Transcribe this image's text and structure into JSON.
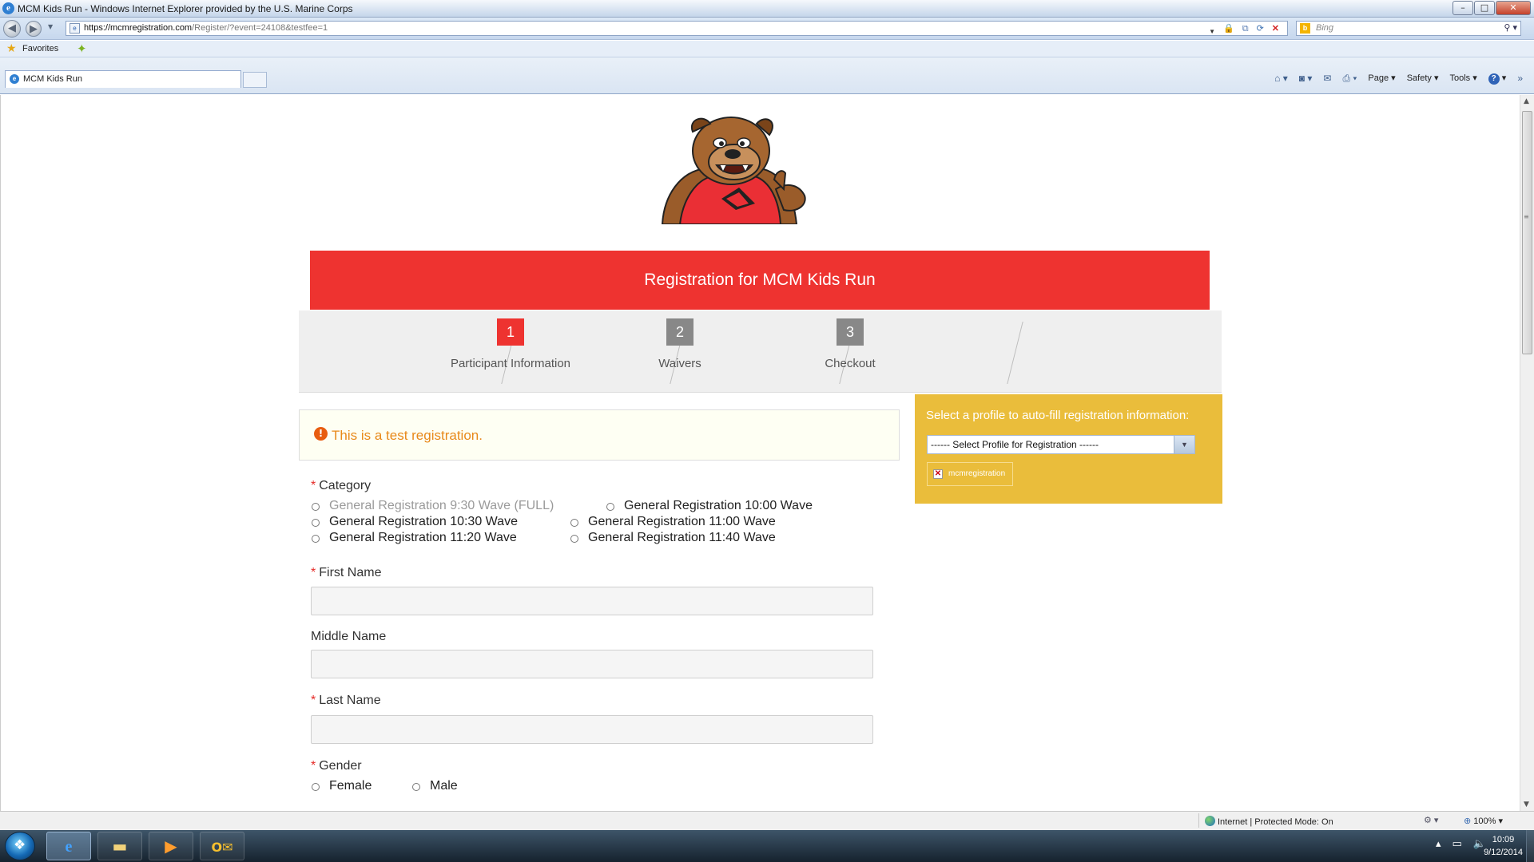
{
  "window": {
    "title": "MCM Kids Run - Windows Internet Explorer provided by the U.S. Marine Corps",
    "minimize": "–",
    "maximize": "□",
    "close": "✕"
  },
  "address": {
    "domain": "https://mcmregistration.com",
    "path": "/Register/?event=24108&testfee=1",
    "search_placeholder": "Bing"
  },
  "favorites": {
    "label": "Favorites"
  },
  "tabs": [
    {
      "label": "MCM Kids Run"
    }
  ],
  "commandbar": {
    "page": "Page ▾",
    "safety": "Safety ▾",
    "tools": "Tools ▾"
  },
  "page": {
    "header": "Registration for MCM Kids Run",
    "steps": [
      {
        "number": "1",
        "label": "Participant Information",
        "active": true
      },
      {
        "number": "2",
        "label": "Waivers",
        "active": false
      },
      {
        "number": "3",
        "label": "Checkout",
        "active": false
      }
    ],
    "notice": "This is a test registration.",
    "profile": {
      "prompt": "Select a profile to auto-fill registration information:",
      "select_value": "------ Select Profile for Registration ------",
      "chip_label": "mcmregistration"
    },
    "form": {
      "category_label": "Category",
      "categories": [
        {
          "label": "General Registration 9:30 Wave (FULL)",
          "disabled": true
        },
        {
          "label": "General Registration 10:00 Wave",
          "disabled": false
        },
        {
          "label": "General Registration 10:30 Wave",
          "disabled": false
        },
        {
          "label": "General Registration 11:00 Wave",
          "disabled": false
        },
        {
          "label": "General Registration 11:20 Wave",
          "disabled": false
        },
        {
          "label": "General Registration 11:40 Wave",
          "disabled": false
        }
      ],
      "first_name_label": "First Name",
      "middle_name_label": "Middle Name",
      "last_name_label": "Last Name",
      "gender_label": "Gender",
      "gender_options": [
        "Female",
        "Male"
      ],
      "required_mark": "*"
    }
  },
  "status": {
    "zone": "Internet | Protected Mode: On",
    "zoom": "100%"
  },
  "taskbar": {
    "time": "10:09",
    "date": "9/12/2014"
  },
  "colors": {
    "brand_red": "#ee3330",
    "profile_yellow": "#eabd3b",
    "notice_orange": "#e8891a"
  }
}
